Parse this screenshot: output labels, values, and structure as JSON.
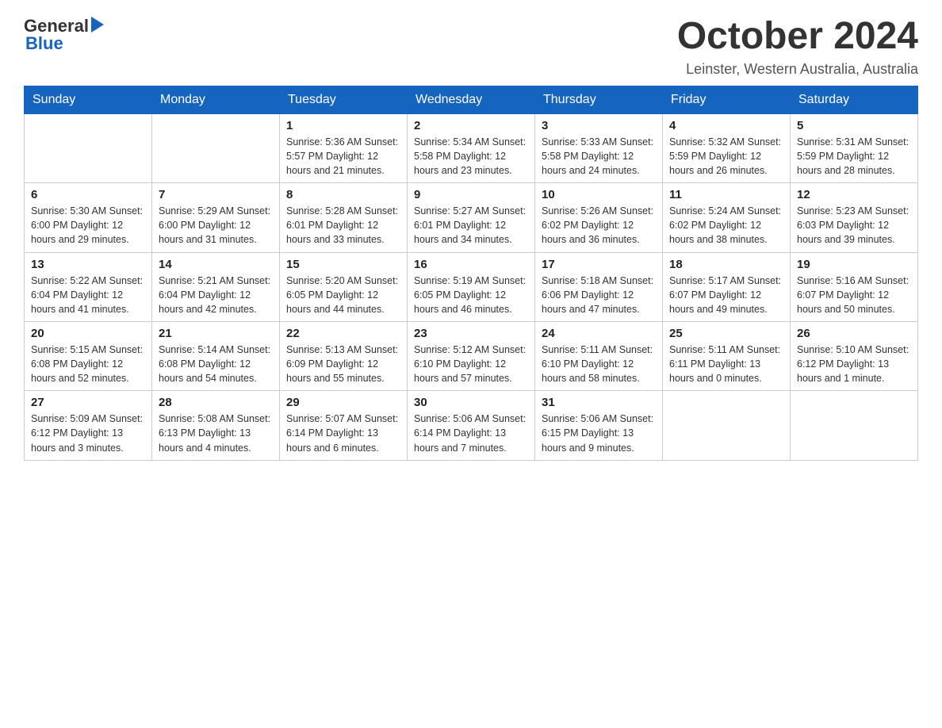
{
  "header": {
    "logo": {
      "general": "General",
      "blue": "Blue"
    },
    "title": "October 2024",
    "location": "Leinster, Western Australia, Australia"
  },
  "calendar": {
    "days_of_week": [
      "Sunday",
      "Monday",
      "Tuesday",
      "Wednesday",
      "Thursday",
      "Friday",
      "Saturday"
    ],
    "weeks": [
      [
        {
          "day": "",
          "info": ""
        },
        {
          "day": "",
          "info": ""
        },
        {
          "day": "1",
          "info": "Sunrise: 5:36 AM\nSunset: 5:57 PM\nDaylight: 12 hours\nand 21 minutes."
        },
        {
          "day": "2",
          "info": "Sunrise: 5:34 AM\nSunset: 5:58 PM\nDaylight: 12 hours\nand 23 minutes."
        },
        {
          "day": "3",
          "info": "Sunrise: 5:33 AM\nSunset: 5:58 PM\nDaylight: 12 hours\nand 24 minutes."
        },
        {
          "day": "4",
          "info": "Sunrise: 5:32 AM\nSunset: 5:59 PM\nDaylight: 12 hours\nand 26 minutes."
        },
        {
          "day": "5",
          "info": "Sunrise: 5:31 AM\nSunset: 5:59 PM\nDaylight: 12 hours\nand 28 minutes."
        }
      ],
      [
        {
          "day": "6",
          "info": "Sunrise: 5:30 AM\nSunset: 6:00 PM\nDaylight: 12 hours\nand 29 minutes."
        },
        {
          "day": "7",
          "info": "Sunrise: 5:29 AM\nSunset: 6:00 PM\nDaylight: 12 hours\nand 31 minutes."
        },
        {
          "day": "8",
          "info": "Sunrise: 5:28 AM\nSunset: 6:01 PM\nDaylight: 12 hours\nand 33 minutes."
        },
        {
          "day": "9",
          "info": "Sunrise: 5:27 AM\nSunset: 6:01 PM\nDaylight: 12 hours\nand 34 minutes."
        },
        {
          "day": "10",
          "info": "Sunrise: 5:26 AM\nSunset: 6:02 PM\nDaylight: 12 hours\nand 36 minutes."
        },
        {
          "day": "11",
          "info": "Sunrise: 5:24 AM\nSunset: 6:02 PM\nDaylight: 12 hours\nand 38 minutes."
        },
        {
          "day": "12",
          "info": "Sunrise: 5:23 AM\nSunset: 6:03 PM\nDaylight: 12 hours\nand 39 minutes."
        }
      ],
      [
        {
          "day": "13",
          "info": "Sunrise: 5:22 AM\nSunset: 6:04 PM\nDaylight: 12 hours\nand 41 minutes."
        },
        {
          "day": "14",
          "info": "Sunrise: 5:21 AM\nSunset: 6:04 PM\nDaylight: 12 hours\nand 42 minutes."
        },
        {
          "day": "15",
          "info": "Sunrise: 5:20 AM\nSunset: 6:05 PM\nDaylight: 12 hours\nand 44 minutes."
        },
        {
          "day": "16",
          "info": "Sunrise: 5:19 AM\nSunset: 6:05 PM\nDaylight: 12 hours\nand 46 minutes."
        },
        {
          "day": "17",
          "info": "Sunrise: 5:18 AM\nSunset: 6:06 PM\nDaylight: 12 hours\nand 47 minutes."
        },
        {
          "day": "18",
          "info": "Sunrise: 5:17 AM\nSunset: 6:07 PM\nDaylight: 12 hours\nand 49 minutes."
        },
        {
          "day": "19",
          "info": "Sunrise: 5:16 AM\nSunset: 6:07 PM\nDaylight: 12 hours\nand 50 minutes."
        }
      ],
      [
        {
          "day": "20",
          "info": "Sunrise: 5:15 AM\nSunset: 6:08 PM\nDaylight: 12 hours\nand 52 minutes."
        },
        {
          "day": "21",
          "info": "Sunrise: 5:14 AM\nSunset: 6:08 PM\nDaylight: 12 hours\nand 54 minutes."
        },
        {
          "day": "22",
          "info": "Sunrise: 5:13 AM\nSunset: 6:09 PM\nDaylight: 12 hours\nand 55 minutes."
        },
        {
          "day": "23",
          "info": "Sunrise: 5:12 AM\nSunset: 6:10 PM\nDaylight: 12 hours\nand 57 minutes."
        },
        {
          "day": "24",
          "info": "Sunrise: 5:11 AM\nSunset: 6:10 PM\nDaylight: 12 hours\nand 58 minutes."
        },
        {
          "day": "25",
          "info": "Sunrise: 5:11 AM\nSunset: 6:11 PM\nDaylight: 13 hours\nand 0 minutes."
        },
        {
          "day": "26",
          "info": "Sunrise: 5:10 AM\nSunset: 6:12 PM\nDaylight: 13 hours\nand 1 minute."
        }
      ],
      [
        {
          "day": "27",
          "info": "Sunrise: 5:09 AM\nSunset: 6:12 PM\nDaylight: 13 hours\nand 3 minutes."
        },
        {
          "day": "28",
          "info": "Sunrise: 5:08 AM\nSunset: 6:13 PM\nDaylight: 13 hours\nand 4 minutes."
        },
        {
          "day": "29",
          "info": "Sunrise: 5:07 AM\nSunset: 6:14 PM\nDaylight: 13 hours\nand 6 minutes."
        },
        {
          "day": "30",
          "info": "Sunrise: 5:06 AM\nSunset: 6:14 PM\nDaylight: 13 hours\nand 7 minutes."
        },
        {
          "day": "31",
          "info": "Sunrise: 5:06 AM\nSunset: 6:15 PM\nDaylight: 13 hours\nand 9 minutes."
        },
        {
          "day": "",
          "info": ""
        },
        {
          "day": "",
          "info": ""
        }
      ]
    ]
  }
}
